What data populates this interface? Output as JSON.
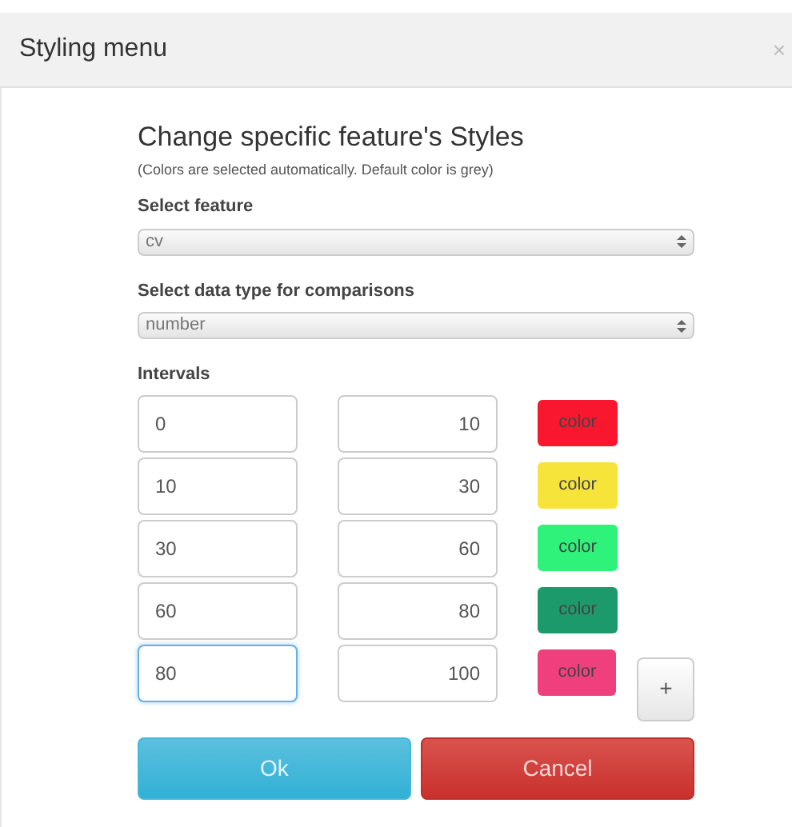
{
  "window": {
    "title": "Styling menu",
    "close": "×"
  },
  "heading": "Change specific feature's Styles",
  "note": "(Colors are selected automatically. Default color is grey)",
  "feature": {
    "label": "Select feature",
    "value": "cv"
  },
  "data_type": {
    "label": "Select data type for comparisons",
    "value": "number"
  },
  "intervals_label": "Intervals",
  "intervals": [
    {
      "from": "0",
      "to": "10",
      "color": "#f8172e",
      "color_label": "color",
      "focused": false
    },
    {
      "from": "10",
      "to": "30",
      "color": "#f7e43b",
      "color_label": "color",
      "focused": false
    },
    {
      "from": "30",
      "to": "60",
      "color": "#2ef27a",
      "color_label": "color",
      "focused": false
    },
    {
      "from": "60",
      "to": "80",
      "color": "#1c9a6c",
      "color_label": "color",
      "focused": false
    },
    {
      "from": "80",
      "to": "100",
      "color": "#ef3f7c",
      "color_label": "color",
      "focused": true
    }
  ],
  "add_button": "+",
  "buttons": [
    {
      "label": "Ok",
      "kind": "primary"
    },
    {
      "label": "Cancel",
      "kind": "danger"
    }
  ]
}
